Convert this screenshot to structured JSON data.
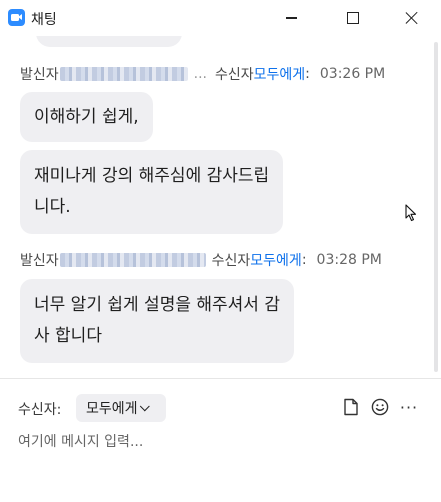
{
  "window": {
    "title": "채팅"
  },
  "messages": [
    {
      "sender_label": "발신자",
      "sender_name_dots": "...",
      "recipient_label": "수신자",
      "recipient": "모두에게",
      "colon": ":",
      "time": "03:26 PM",
      "bubbles": [
        "이해하기 쉽게,",
        "재미나게 강의 해주심에 감사드립",
        "니다."
      ]
    },
    {
      "sender_label": "발신자",
      "recipient_label": "수신자",
      "recipient": "모두에게",
      "colon": ":",
      "time": "03:28 PM",
      "bubbles": [
        "너무 알기 쉽게 설명을 해주셔서 감",
        "사 합니다"
      ]
    }
  ],
  "composer": {
    "recipient_label": "수신자:",
    "recipient_value": "모두에게",
    "placeholder": "여기에 메시지 입력...",
    "more_label": "···"
  },
  "icons": {
    "app": "zoom-camera-icon",
    "file": "file-icon",
    "emoji": "emoji-icon",
    "more": "more-icon"
  },
  "colors": {
    "accent": "#0e71eb",
    "bubble": "#efeff2",
    "logo": "#2d8cff"
  }
}
